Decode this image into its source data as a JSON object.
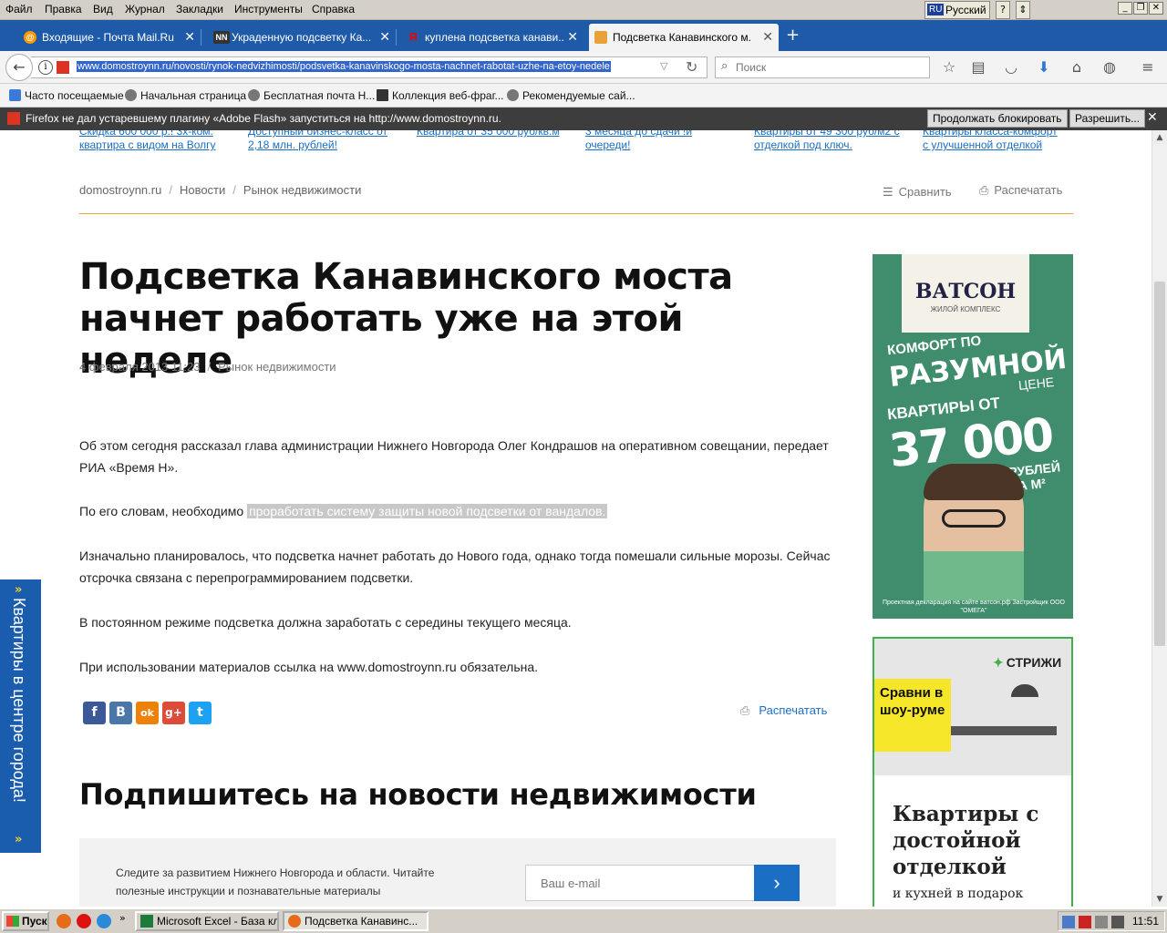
{
  "menubar": {
    "items": [
      "Файл",
      "Правка",
      "Вид",
      "Журнал",
      "Закладки",
      "Инструменты",
      "Справка"
    ],
    "lang_code": "RU",
    "lang_name": "Русский",
    "help_glyph": "?"
  },
  "tabs": [
    {
      "title": "Входящие - Почта Mail.Ru",
      "favicon": "mailru-icon",
      "fav_text": "@"
    },
    {
      "title": "Украденную подсветку Ка...",
      "favicon": "nn-icon",
      "fav_text": "NN"
    },
    {
      "title": "куплена подсветка канави...",
      "favicon": "yandex-icon",
      "fav_text": "Я"
    },
    {
      "title": "Подсветка Канавинского м...",
      "favicon": "domostroy-icon",
      "fav_text": ""
    }
  ],
  "navbar": {
    "url": "www.domostroynn.ru/novosti/rynok-nedvizhimosti/podsvetka-kanavinskogo-mosta-nachnet-rabotat-uzhe-na-etoy-nedele",
    "search_placeholder": "Поиск"
  },
  "bookmarks": [
    "Часто посещаемые",
    "Начальная страница",
    "Бесплатная почта Н...",
    "Коллекция веб-фраг...",
    "Рекомендуемые сай..."
  ],
  "flash": {
    "message": "Firefox не дал устаревшему плагину «Adobe Flash» запуститься на http://www.domostroynn.ru.",
    "continue_label": "Продолжать блокировать",
    "allow_label": "Разрешить..."
  },
  "top_links": [
    {
      "line1": "Скидка 600 000 р.! 3х-ком.",
      "line2": "квартира с видом на Волгу"
    },
    {
      "line1": "Доступный бизнес-класс от",
      "line2": "2,18 млн. рублей!"
    },
    {
      "line1": "Квартира от 35 000 руб/кв.м",
      "line2": ""
    },
    {
      "line1": "3 месяца до сдачи !и",
      "line2": "очереди!"
    },
    {
      "line1": "Квартиры от 49 300 руб/м2 с",
      "line2": "отделкой под ключ."
    },
    {
      "line1": "Квартиры класса-комфорт",
      "line2": "с улучшенной отделкой"
    }
  ],
  "breadcrumbs": [
    "domostroynn.ru",
    "Новости",
    "Рынок недвижимости"
  ],
  "breadcrumb_sep": "/",
  "actions": {
    "compare": "Сравнить",
    "print": "Распечатать"
  },
  "article": {
    "title": "Подсветка Канавинского моста начнет работать уже на этой неделе",
    "date": "4 февраля 2013 11:23",
    "category": "Рынок недвижимости",
    "p1": "Об этом сегодня рассказал глава администрации Нижнего Новгорода Олег Кондрашов на оперативном совещании, передает РИА «Время Н».",
    "p2_pre": "По его словам, необходимо ",
    "p2_hl": "проработать систему защиты новой подсветки от вандалов.",
    "p3": "Изначально планировалось, что подсветка начнет работать до Нового года, однако тогда помешали сильные морозы. Сейчас отсрочка связана с перепрограммированием подсветки.",
    "p4": "В постоянном режиме подсветка должна заработать с середины текущего месяца.",
    "p5": "При использовании материалов ссылка на www.domostroynn.ru обязательна."
  },
  "social": [
    {
      "name": "facebook-icon",
      "glyph": "f",
      "color": "#3b5998"
    },
    {
      "name": "vkontakte-icon",
      "glyph": "B",
      "color": "#4a76a8"
    },
    {
      "name": "odnoklassniki-icon",
      "glyph": "ok",
      "color": "#ee8208"
    },
    {
      "name": "googleplus-icon",
      "glyph": "g+",
      "color": "#dd4b39"
    },
    {
      "name": "twitter-icon",
      "glyph": "t",
      "color": "#1da1f2"
    }
  ],
  "print_bottom": "Распечатать",
  "subscribe": {
    "title": "Подпишитесь на новости недвижимости",
    "text": "Следите за развитием Нижнего Новгорода и области. Читайте полезные инструкции и познавательные материалы",
    "email_placeholder": "Ваш e-mail",
    "submit_glyph": "›"
  },
  "ad1": {
    "brand": "ВАТСОН",
    "brand_sub": "ЖИЛОЙ КОМПЛЕКС",
    "l1": "КОМФОРТ ПО",
    "l2": "РАЗУМНОЙ",
    "l3": "ЦЕНЕ",
    "l4": "КВАРТИРЫ ОТ",
    "l5": "37 000",
    "l6": "РУБЛЕЙ ЗА М²",
    "legal": "Проектная декларация на сайте ватсон.рф Застройщик ООО \"ОМЕГА\""
  },
  "ad2": {
    "brand": "СТРИЖИ",
    "yellow": "Сравни в шоу-руме",
    "big": "Квартиры с достойной отделкой",
    "small": "и кухней в подарок"
  },
  "sidetab": {
    "text": "Квартиры в центре города!",
    "arrow": "»"
  },
  "taskbar": {
    "start": "Пуск",
    "tasks": [
      "Microsoft Excel - База кл...",
      "Подсветка Канавинс..."
    ],
    "clock": "11:51"
  },
  "colors": {
    "accent": "#1a6fc4",
    "divider": "#e8a23a",
    "tabbar": "#1e5aa8"
  }
}
